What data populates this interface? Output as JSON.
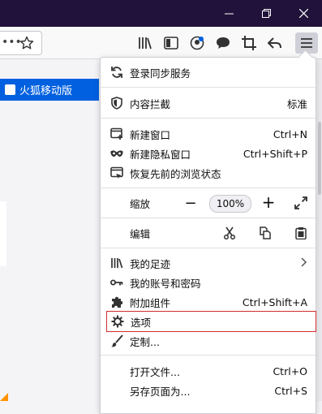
{
  "bookmark": {
    "label": "火狐移动版"
  },
  "menu": {
    "sync": "登录同步服务",
    "content_blocking": "内容拦截",
    "content_blocking_value": "标准",
    "new_window": "新建窗口",
    "new_window_shortcut": "Ctrl+N",
    "new_private": "新建隐私窗口",
    "new_private_shortcut": "Ctrl+Shift+P",
    "restore_session": "恢复先前的浏览状态",
    "zoom": "缩放",
    "zoom_minus": "−",
    "zoom_value": "100%",
    "zoom_plus": "+",
    "edit": "编辑",
    "library": "我的足迹",
    "logins": "我的账号和密码",
    "addons": "附加组件",
    "addons_shortcut": "Ctrl+Shift+A",
    "options": "选项",
    "customize": "定制...",
    "open_file": "打开文件...",
    "open_file_shortcut": "Ctrl+O",
    "save_page": "另存页面为...",
    "save_page_shortcut": "Ctrl+S"
  },
  "colors": {
    "titlebar": "#20123a",
    "accent": "#0060df",
    "highlight": "#d22d2d"
  }
}
